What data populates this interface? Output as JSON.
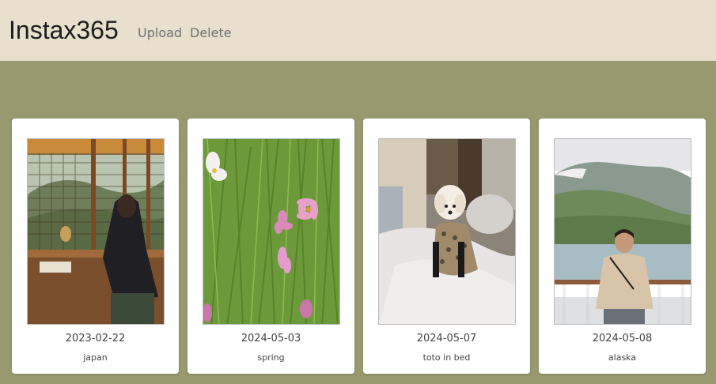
{
  "header": {
    "brand": "Instax365",
    "nav": {
      "upload_label": "Upload",
      "delete_label": "Delete"
    }
  },
  "colors": {
    "page_background": "#98996f",
    "navbar_background": "#e8e0cc",
    "card_background": "#ffffff"
  },
  "photos": [
    {
      "date": "2023-02-22",
      "caption": "japan",
      "image_subject": "person-at-window-photo"
    },
    {
      "date": "2024-05-03",
      "caption": "spring",
      "image_subject": "cosmos-flowers-photo"
    },
    {
      "date": "2024-05-07",
      "caption": "toto in bed",
      "image_subject": "dog-on-bed-photo"
    },
    {
      "date": "2024-05-08",
      "caption": "alaska",
      "image_subject": "person-mountains-photo"
    }
  ]
}
